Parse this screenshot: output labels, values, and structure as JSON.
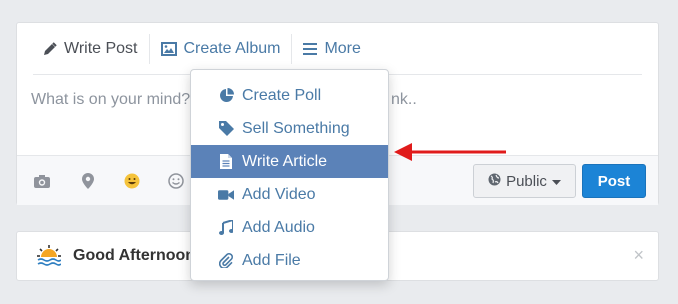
{
  "composer": {
    "tabs": [
      {
        "label": "Write Post",
        "icon": "pencil-icon"
      },
      {
        "label": "Create Album",
        "icon": "image-icon"
      },
      {
        "label": "More",
        "icon": "bars-icon"
      }
    ],
    "placeholder_start": "What is on your mind?",
    "placeholder_end": "nk..",
    "privacy_label": "Public",
    "post_label": "Post"
  },
  "dropdown": {
    "items": [
      {
        "label": "Create Poll",
        "icon": "pie-chart-icon"
      },
      {
        "label": "Sell Something",
        "icon": "tag-icon"
      },
      {
        "label": "Write Article",
        "icon": "file-text-icon",
        "selected": true
      },
      {
        "label": "Add Video",
        "icon": "video-camera-icon"
      },
      {
        "label": "Add Audio",
        "icon": "music-icon"
      },
      {
        "label": "Add File",
        "icon": "paperclip-icon"
      }
    ]
  },
  "greeting": {
    "text": "Good Afternoon,",
    "close": "×"
  },
  "colors": {
    "accent": "#4a7aa6",
    "post_button": "#1c84d6",
    "selected_item": "#5b82b8",
    "annotation_arrow": "#e01b1b"
  }
}
